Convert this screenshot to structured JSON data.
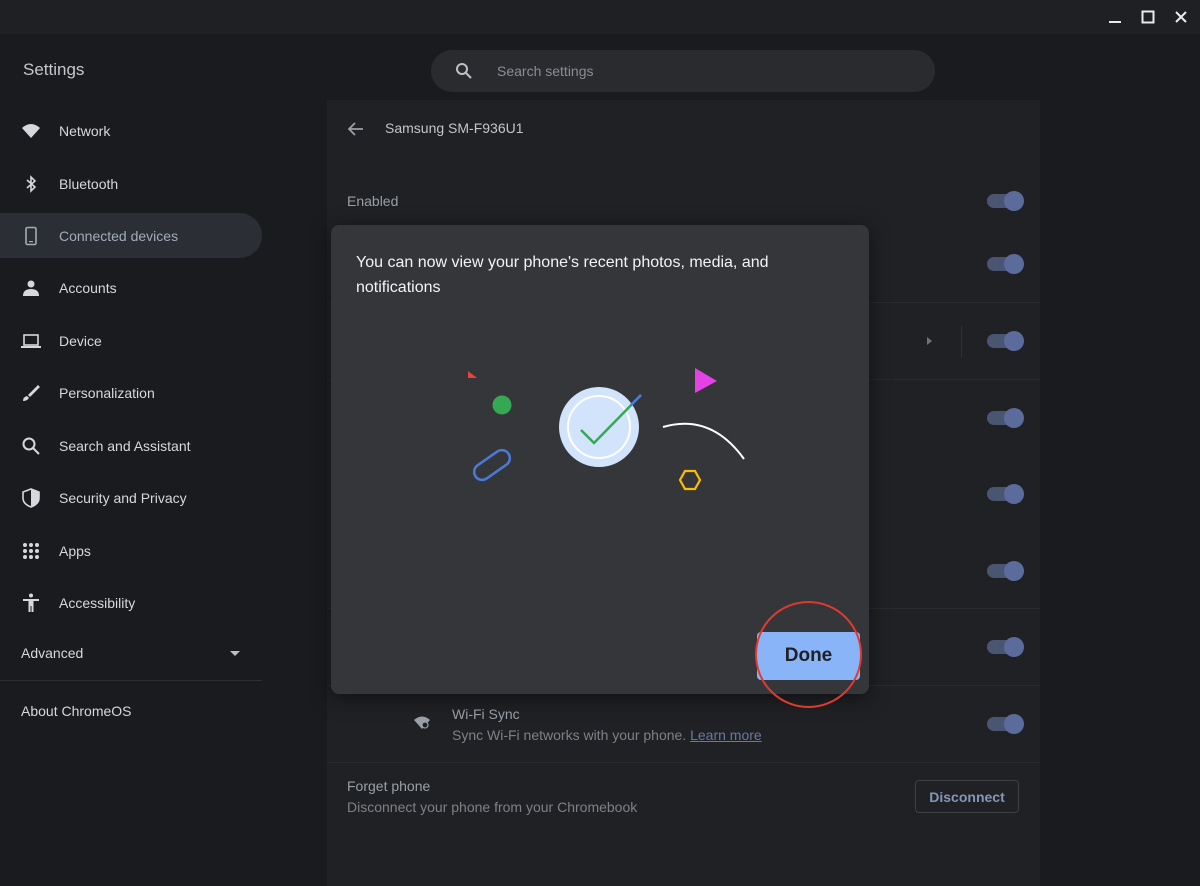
{
  "window": {
    "title": "Settings",
    "controls": [
      "minimize-icon",
      "maximize-icon",
      "close-icon"
    ]
  },
  "search": {
    "placeholder": "Search settings",
    "icon": "search-icon"
  },
  "sidebar": {
    "items": [
      {
        "label": "Network",
        "icon": "wifi-icon"
      },
      {
        "label": "Bluetooth",
        "icon": "bluetooth-icon"
      },
      {
        "label": "Connected devices",
        "icon": "phone-icon",
        "active": true
      },
      {
        "label": "Accounts",
        "icon": "person-icon"
      },
      {
        "label": "Device",
        "icon": "laptop-icon"
      },
      {
        "label": "Personalization",
        "icon": "brush-icon"
      },
      {
        "label": "Search and Assistant",
        "icon": "search-icon"
      },
      {
        "label": "Security and Privacy",
        "icon": "shield-icon"
      },
      {
        "label": "Apps",
        "icon": "apps-grid-icon"
      },
      {
        "label": "Accessibility",
        "icon": "accessibility-icon"
      }
    ],
    "advanced_label": "Advanced",
    "about_label": "About ChromeOS"
  },
  "page": {
    "title": "Samsung SM-F936U1",
    "enabled_label": "Enabled",
    "wifi_sync": {
      "label": "Wi-Fi Sync",
      "description": "Sync Wi-Fi networks with your phone.",
      "link": "Learn more"
    },
    "forget": {
      "label": "Forget phone",
      "description": "Disconnect your phone from your Chromebook",
      "button": "Disconnect"
    },
    "toggles_on": 8
  },
  "dialog": {
    "title": "You can now view your phone's recent photos, media, and notifications",
    "done_label": "Done"
  },
  "colors": {
    "accent": "#8ab4f8",
    "highlight_ring": "#e03a2f",
    "toggle_track": "#4a5572",
    "toggle_knob": "#5b6c9c"
  }
}
